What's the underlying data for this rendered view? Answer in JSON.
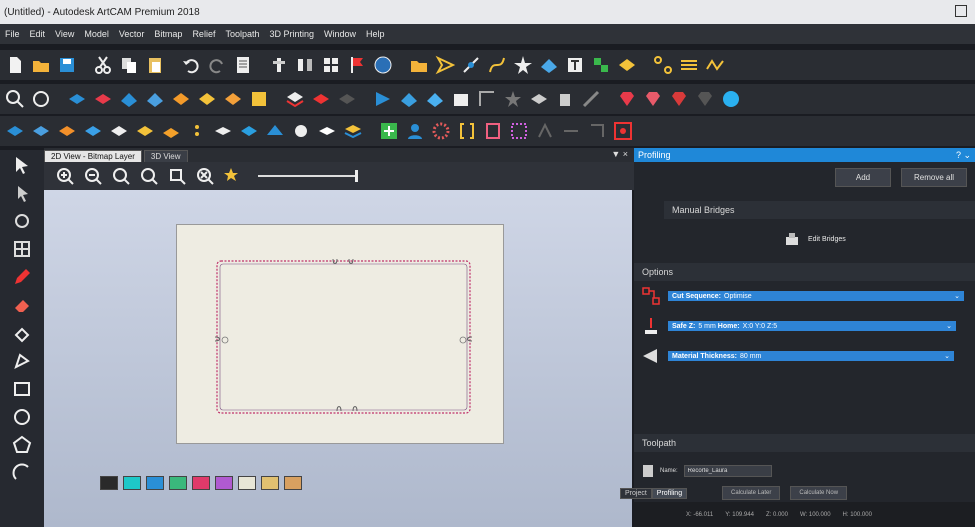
{
  "window": {
    "title": "(Untitled) - Autodesk ArtCAM Premium 2018"
  },
  "menu": [
    "File",
    "Edit",
    "View",
    "Model",
    "Vector",
    "Bitmap",
    "Relief",
    "Toolpath",
    "3D Printing",
    "Window",
    "Help"
  ],
  "view_tabs": [
    "2D View - Bitmap Layer",
    "3D View"
  ],
  "view_controls": "▼ ×",
  "panel": {
    "title": "Profiling",
    "help": "? ⌄",
    "add_label": "Add",
    "remove_all_label": "Remove all",
    "manual_bridges": "Manual Bridges",
    "edit_bridges": "Edit Bridges",
    "options_title": "Options",
    "options": [
      {
        "label": "Cut Sequence:",
        "value": "Optimise"
      },
      {
        "label": "Safe Z:",
        "value": "5 mm",
        "label2": "Home:",
        "value2": "X:0 Y:0 Z:5"
      },
      {
        "label": "Material Thickness:",
        "value": "80 mm"
      }
    ],
    "toolpath_title": "Toolpath",
    "name_label": "Name:",
    "name_value": "Recorte_Laura",
    "calculate_later": "Calculate Later",
    "calculate_now": "Calculate Now"
  },
  "bottom_tabs": [
    "Project",
    "Profiling"
  ],
  "status": {
    "x": "X: -66.011",
    "y": "Y: 109.944",
    "z": "Z: 0.000",
    "w": "W: 100.000",
    "h": "H: 100.000"
  },
  "swatch_colors": [
    "#2a2a2a",
    "#1ec8c8",
    "#2a8fd6",
    "#3ab87c",
    "#e03a6a",
    "#b05ad0",
    "#e8e6d6",
    "#e0c070",
    "#d8a060"
  ],
  "colors": {
    "accent": "#1f88d8",
    "option_bar": "#2e84d6"
  }
}
